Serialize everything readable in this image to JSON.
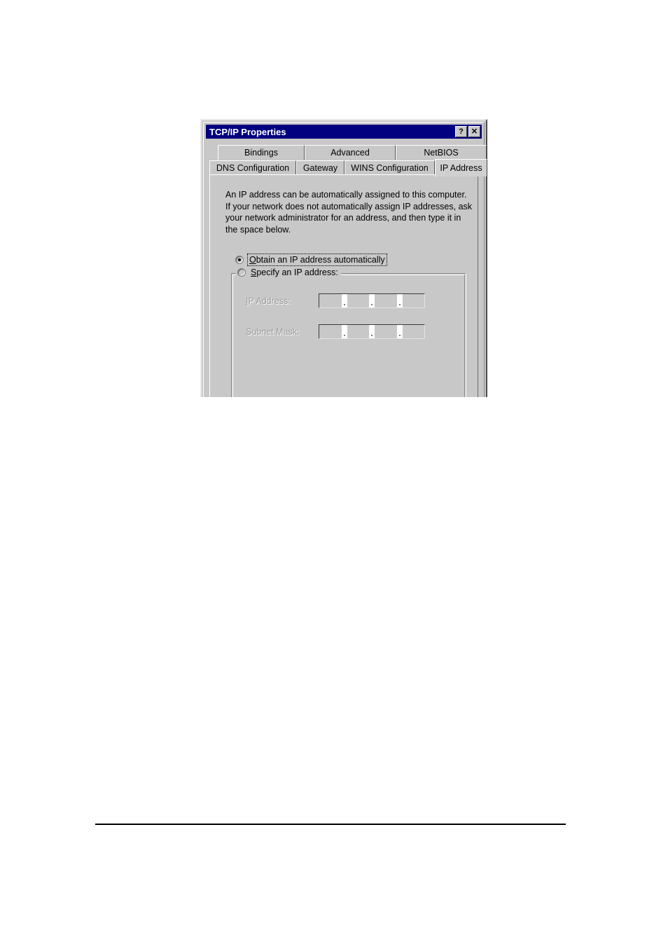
{
  "document": {
    "background_color": "#ffffff",
    "footer_rule_color": "#000000"
  },
  "dialog": {
    "title": "TCP/IP Properties",
    "titlebar_color": "#000080",
    "titlebar_text_color": "#ffffff",
    "face_color": "#c8c8c8",
    "buttons": {
      "help": "?",
      "close": "✕"
    },
    "tab_rows": [
      {
        "tabs": [
          {
            "label": "Bindings",
            "active": false
          },
          {
            "label": "Advanced",
            "active": false
          },
          {
            "label": "NetBIOS",
            "active": false
          }
        ]
      },
      {
        "tabs": [
          {
            "label": "DNS Configuration",
            "active": false
          },
          {
            "label": "Gateway",
            "active": false
          },
          {
            "label": "WINS Configuration",
            "active": false
          },
          {
            "label": "IP Address",
            "active": true
          }
        ]
      }
    ],
    "panel": {
      "description_lines": [
        "An IP address can be automatically assigned to this computer.",
        "If your network does not automatically assign IP addresses, ask",
        "your network administrator for an address, and then type it in",
        "the space below."
      ],
      "options": [
        {
          "accelerator": "O",
          "label_rest": "btain an IP address automatically",
          "selected": true,
          "focused": true
        },
        {
          "accelerator": "S",
          "label_rest": "pecify an IP address:",
          "selected": false,
          "focused": false
        }
      ],
      "fields": [
        {
          "accelerator": "I",
          "label_rest": "P Address:",
          "value": "",
          "enabled": false,
          "octets": [
            "",
            "",
            "",
            ""
          ],
          "separator": "."
        },
        {
          "accelerator": "S",
          "label_prefix": "S",
          "label_rest": "ubnet Mask:",
          "value": "",
          "enabled": false,
          "octets": [
            "",
            "",
            "",
            ""
          ],
          "separator": "."
        }
      ]
    }
  }
}
